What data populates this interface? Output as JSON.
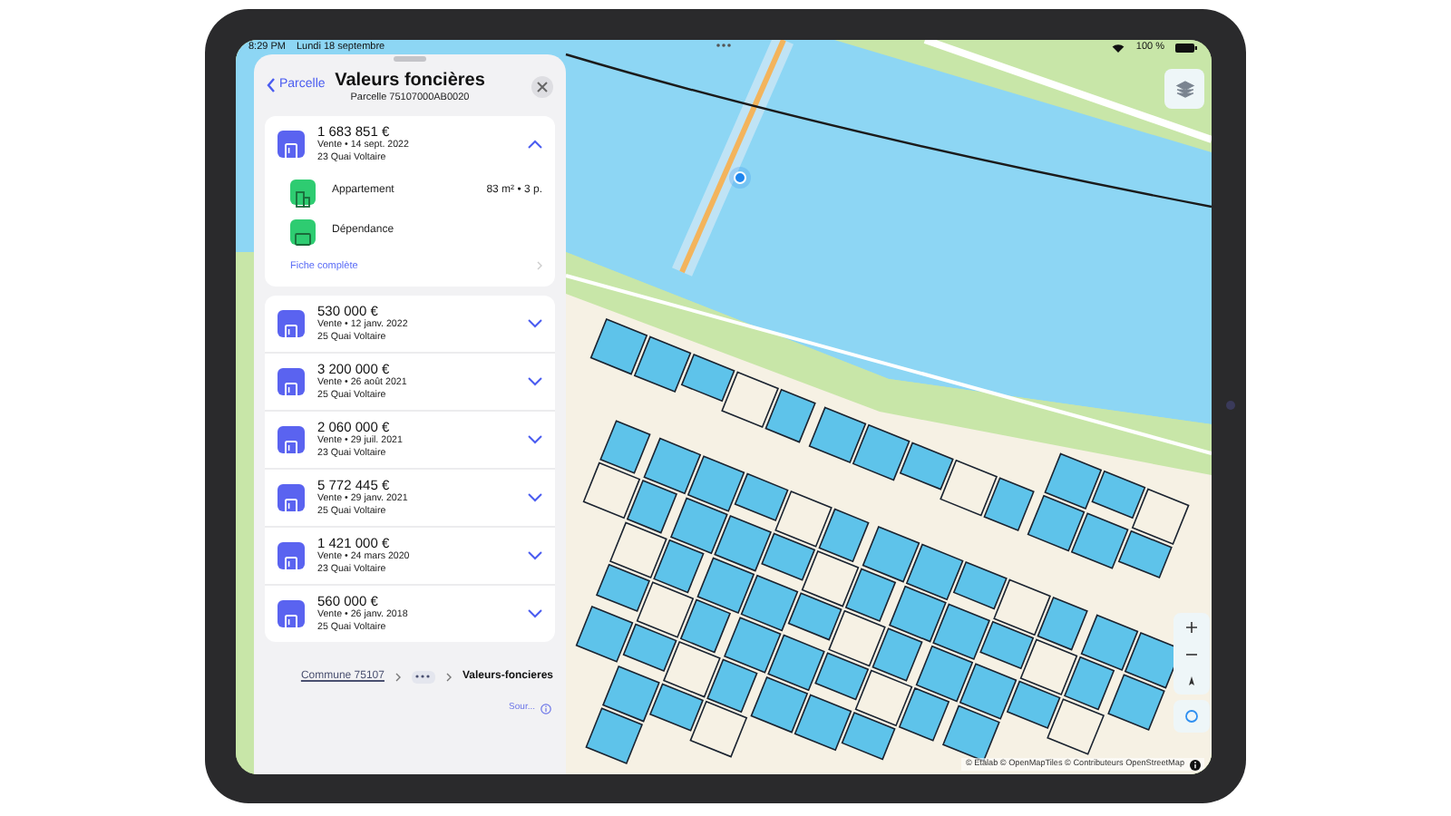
{
  "status_bar": {
    "time": "8:29 PM",
    "date": "Lundi 18 septembre",
    "battery": "100 %"
  },
  "panel": {
    "back_label": "Parcelle",
    "title": "Valeurs foncières",
    "subtitle": "Parcelle 75107000AB0020"
  },
  "sales": [
    {
      "price": "1 683 851 €",
      "date": "Vente • 14 sept. 2022",
      "address": "23 Quai Voltaire",
      "expanded": true,
      "lots": [
        {
          "kind": "appartement",
          "label": "Appartement",
          "detail": "83 m² • 3 p."
        },
        {
          "kind": "dependance",
          "label": "Dépendance"
        }
      ],
      "link": "Fiche complète"
    },
    {
      "price": "530 000 €",
      "date": "Vente • 12 janv. 2022",
      "address": "25 Quai Voltaire",
      "expanded": false
    },
    {
      "price": "3 200 000 €",
      "date": "Vente • 26 août 2021",
      "address": "25 Quai Voltaire",
      "expanded": false
    },
    {
      "price": "2 060 000 €",
      "date": "Vente • 29 juil. 2021",
      "address": "23 Quai Voltaire",
      "expanded": false
    },
    {
      "price": "5 772 445 €",
      "date": "Vente • 29 janv. 2021",
      "address": "25 Quai Voltaire",
      "expanded": false
    },
    {
      "price": "1 421 000 €",
      "date": "Vente • 24 mars 2020",
      "address": "23 Quai Voltaire",
      "expanded": false
    },
    {
      "price": "560 000 €",
      "date": "Vente • 26 janv. 2018",
      "address": "25 Quai Voltaire",
      "expanded": false
    }
  ],
  "breadcrumb": [
    {
      "kind": "link",
      "label": "Commune 75107"
    },
    {
      "kind": "more"
    },
    {
      "kind": "current",
      "label": "Valeurs-foncieres"
    }
  ],
  "source_label": "Sour...",
  "attribution": "© Etalab © OpenMapTiles © Contributeurs OpenStreetMap"
}
